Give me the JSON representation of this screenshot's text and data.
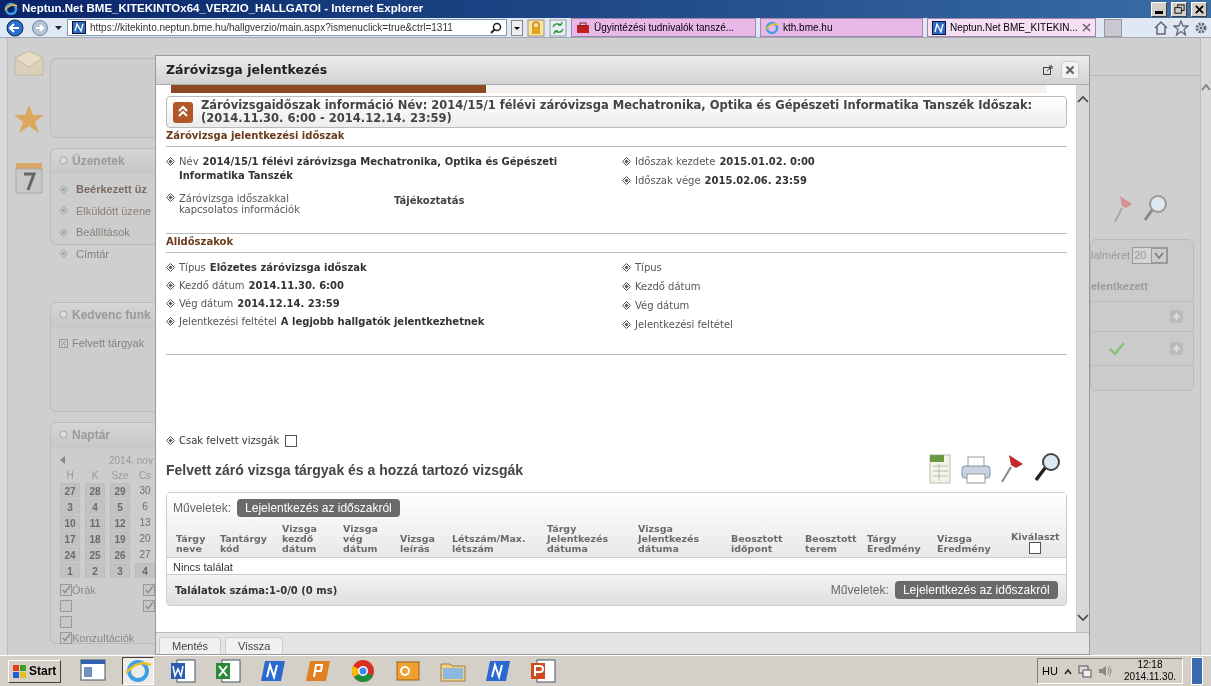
{
  "browser": {
    "title": "Neptun.Net BME_KITEKINTOx64_VERZIO_HALLGATOI - Internet Explorer",
    "url": "https://kitekinto.neptun.bme.hu/hallgverzio/main.aspx?ismenuclick=true&ctrl=1311",
    "tabs": [
      {
        "label": "Ügyintézési tudnivalók tanszé...",
        "selected": false,
        "kind": "briefcase"
      },
      {
        "label": "kth.bme.hu",
        "selected": false,
        "kind": "globe"
      },
      {
        "label": "Neptun.Net BME_KITEKIN...",
        "selected": true,
        "kind": "neptun"
      }
    ]
  },
  "background": {
    "panels": [
      {
        "title": "Üzenetek",
        "items": [
          {
            "label": "Beérkezett üz",
            "bold": true,
            "kind": "link"
          },
          {
            "label": "Elküldött üzene",
            "bold": false,
            "kind": "link"
          },
          {
            "label": "Beállítások",
            "bold": false,
            "kind": "link"
          },
          {
            "label": "Címtár",
            "bold": false,
            "kind": "link"
          }
        ]
      },
      {
        "title": "Kedvenc funk",
        "items": [
          {
            "label": "Felvett tárgyak",
            "bold": false,
            "kind": "favorite"
          }
        ]
      }
    ],
    "calendar": {
      "title": "Naptár",
      "month": "2014. nov",
      "weekdays": [
        "H",
        "K",
        "Sze",
        "Cs"
      ],
      "weeks": [
        [
          {
            "day": "27",
            "boxed": true
          },
          {
            "day": "28",
            "boxed": true
          },
          {
            "day": "29",
            "boxed": true
          },
          {
            "day": "30",
            "boxed": false
          }
        ],
        [
          {
            "day": "3",
            "boxed": true
          },
          {
            "day": "4",
            "boxed": true
          },
          {
            "day": "5",
            "boxed": true
          },
          {
            "day": "6",
            "boxed": false
          }
        ],
        [
          {
            "day": "10",
            "boxed": true
          },
          {
            "day": "11",
            "boxed": true
          },
          {
            "day": "12",
            "boxed": true
          },
          {
            "day": "13",
            "boxed": false
          }
        ],
        [
          {
            "day": "17",
            "boxed": true
          },
          {
            "day": "18",
            "boxed": true
          },
          {
            "day": "19",
            "boxed": true
          },
          {
            "day": "20",
            "boxed": false
          }
        ],
        [
          {
            "day": "24",
            "boxed": true
          },
          {
            "day": "25",
            "boxed": true
          },
          {
            "day": "26",
            "boxed": true
          },
          {
            "day": "27",
            "boxed": false
          }
        ],
        [
          {
            "day": "1",
            "boxed": true
          },
          {
            "day": "2",
            "boxed": true
          },
          {
            "day": "3",
            "boxed": true
          },
          {
            "day": "4",
            "boxed": true
          }
        ]
      ]
    },
    "filters": [
      {
        "label": "Órák",
        "checked": true
      },
      {
        "checked": false
      },
      {
        "checked": false
      },
      {
        "label": "Konzultációk",
        "checked": true
      },
      {
        "checked": true
      },
      {
        "checked": true
      }
    ],
    "page_size_label": "lalméret",
    "page_size": "20",
    "column_label": "elentkezett"
  },
  "modal": {
    "title": "Záróvizsga jelentkezés",
    "loading_bar": {
      "level": 0.36
    },
    "info_title": "Záróvizsgaidőszak információ Név: 2014/15/1 félévi záróvizsga Mechatronika, Optika és Gépészeti Informatika Tanszék Időszak: (2014.11.30. 6:00 - 2014.12.14. 23:59)",
    "sections": [
      {
        "title": "Záróvizsga jelentkezési időszak",
        "left": [
          {
            "kind": "inline",
            "label": "Név",
            "value": "2014/15/1 félévi záróvizsga Mechatronika, Optika és Gépészeti Informatika Tanszék"
          },
          {
            "kind": "split",
            "label": "Záróvizsga időszakkal kapcsolatos információk",
            "value": "Tájékoztatás"
          }
        ],
        "right": [
          {
            "kind": "inline",
            "label": "Időszak kezdete",
            "value": "2015.01.02. 0:00"
          },
          {
            "kind": "inline",
            "label": "Időszak vége",
            "value": "2015.02.06. 23:59"
          }
        ]
      },
      {
        "title": "Alidőszakok",
        "left": [
          {
            "kind": "inline",
            "label": "Típus",
            "value": "Előzetes záróvizsga időszak"
          },
          {
            "kind": "inline",
            "label": "Kezdő dátum",
            "value": "2014.11.30. 6:00"
          },
          {
            "kind": "inline",
            "label": "Vég dátum",
            "value": "2014.12.14. 23:59"
          },
          {
            "kind": "inline",
            "label": "Jelentkezési feltétel",
            "value": "A legjobb hallgatók jelentkezhetnek"
          }
        ],
        "right": [
          {
            "kind": "inline",
            "label": "Típus"
          },
          {
            "kind": "inline",
            "label": "Kezdő dátum"
          },
          {
            "kind": "inline",
            "label": "Vég dátum"
          },
          {
            "kind": "inline",
            "label": "Jelentkezési feltétel"
          }
        ]
      }
    ],
    "filter": {
      "label": "Csak felvett vizsgák",
      "checked": false
    },
    "table": {
      "title": "Felvett záró vizsga tárgyak és a hozzá tartozó vizsgák",
      "actions_label": "Műveletek:",
      "action_button": "Lejelentkezés az időszakról",
      "columns": [
        "Tárgy neve",
        "Tantárgy kód",
        "Vizsga kezdő dátum",
        "Vizsga vég dátum",
        "Vizsga leírás",
        "Létszám/Max. létszám",
        "Tárgy Jelentkezés dátuma",
        "Vizsga Jelentkezés dátuma",
        "Beosztott időpont",
        "Beosztott terem",
        "Tárgy Eredmény",
        "Vizsga Eredmény",
        "Kiválaszt"
      ],
      "select_all_checked": false,
      "empty_text": "Nincs találat",
      "footer": "Találatok száma:1-0/0 (0 ms)",
      "footer_actions_label": "Műveletek:",
      "footer_action_button": "Lejelentkezés az időszakról"
    },
    "buttons": [
      "Mentés",
      "Vissza"
    ]
  },
  "taskbar": {
    "start": "Start",
    "apps": [
      {
        "kind": "desktop",
        "selected": false
      },
      {
        "kind": "globe",
        "selected": true
      },
      {
        "kind": "word",
        "selected": false
      },
      {
        "kind": "excel",
        "selected": false
      },
      {
        "kind": "neptun",
        "selected": false
      },
      {
        "kind": "orange",
        "selected": false
      },
      {
        "kind": "chrome",
        "selected": false
      },
      {
        "kind": "outlook",
        "selected": false
      },
      {
        "kind": "folder",
        "selected": false
      },
      {
        "kind": "neptun",
        "selected": false
      },
      {
        "kind": "powerpoint",
        "selected": false
      }
    ],
    "language": "HU",
    "time": "12:18",
    "date": "2014.11.30."
  }
}
